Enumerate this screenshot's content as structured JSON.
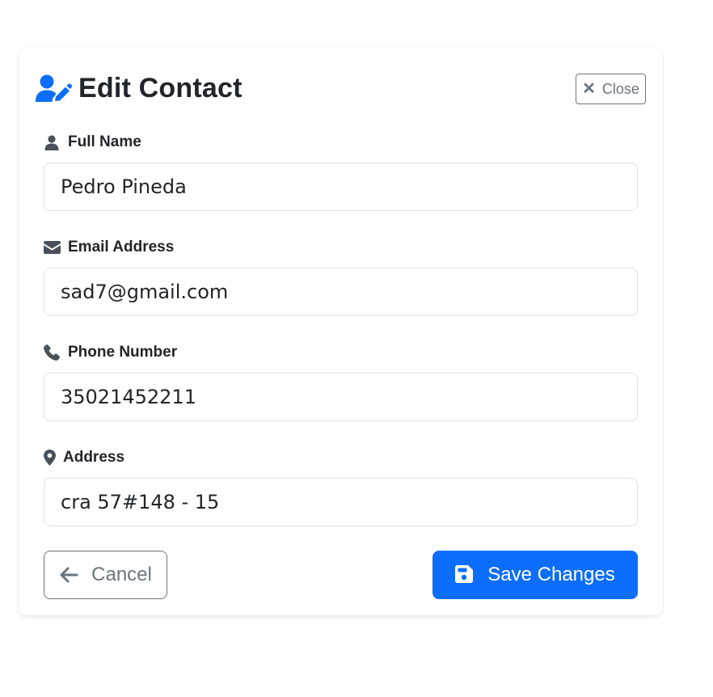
{
  "dialog": {
    "title": "Edit Contact",
    "title_icon": "user-edit-icon",
    "close_label": "Close",
    "accent_color": "#0d6efd"
  },
  "fields": [
    {
      "label": "Full Name",
      "icon": "user-icon",
      "value": "Pedro Pineda"
    },
    {
      "label": "Email Address",
      "icon": "envelope-icon",
      "value": "sad7@gmail.com"
    },
    {
      "label": "Phone Number",
      "icon": "phone-icon",
      "value": "35021452211"
    },
    {
      "label": "Address",
      "icon": "map-marker-icon",
      "value": "cra 57#148 - 15"
    }
  ],
  "actions": {
    "cancel_label": "Cancel",
    "save_label": "Save Changes"
  }
}
